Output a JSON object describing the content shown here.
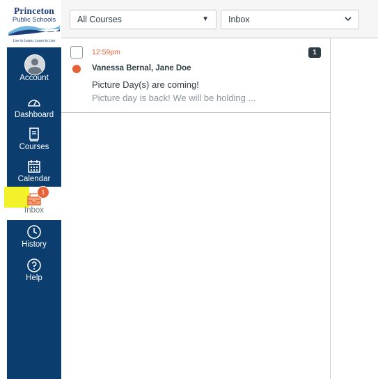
{
  "logo": {
    "line1": "Princeton",
    "line2": "Public Schools",
    "tagline": "Live to Learn, Learn to Live"
  },
  "nav": {
    "items": [
      {
        "label": "Account",
        "icon": "account-avatar-icon"
      },
      {
        "label": "Dashboard",
        "icon": "dashboard-gauge-icon"
      },
      {
        "label": "Courses",
        "icon": "book-icon"
      },
      {
        "label": "Calendar",
        "icon": "calendar-icon"
      },
      {
        "label": "Inbox",
        "icon": "inbox-icon",
        "badge": "1",
        "active": true
      },
      {
        "label": "History",
        "icon": "clock-icon"
      },
      {
        "label": "Help",
        "icon": "question-icon"
      }
    ]
  },
  "toolbar": {
    "course_filter": "All Courses",
    "mailbox_filter": "Inbox"
  },
  "messages": [
    {
      "time": "12:59pm",
      "count": "1",
      "participants": "Vanessa Bernal, Jane Doe",
      "subject": "Picture Day(s) are coming!",
      "preview": "Picture day is back! We will be holding ..."
    }
  ],
  "colors": {
    "nav_bg": "#0b3d6e",
    "accent": "#e66135",
    "highlight": "#f3f22a"
  }
}
